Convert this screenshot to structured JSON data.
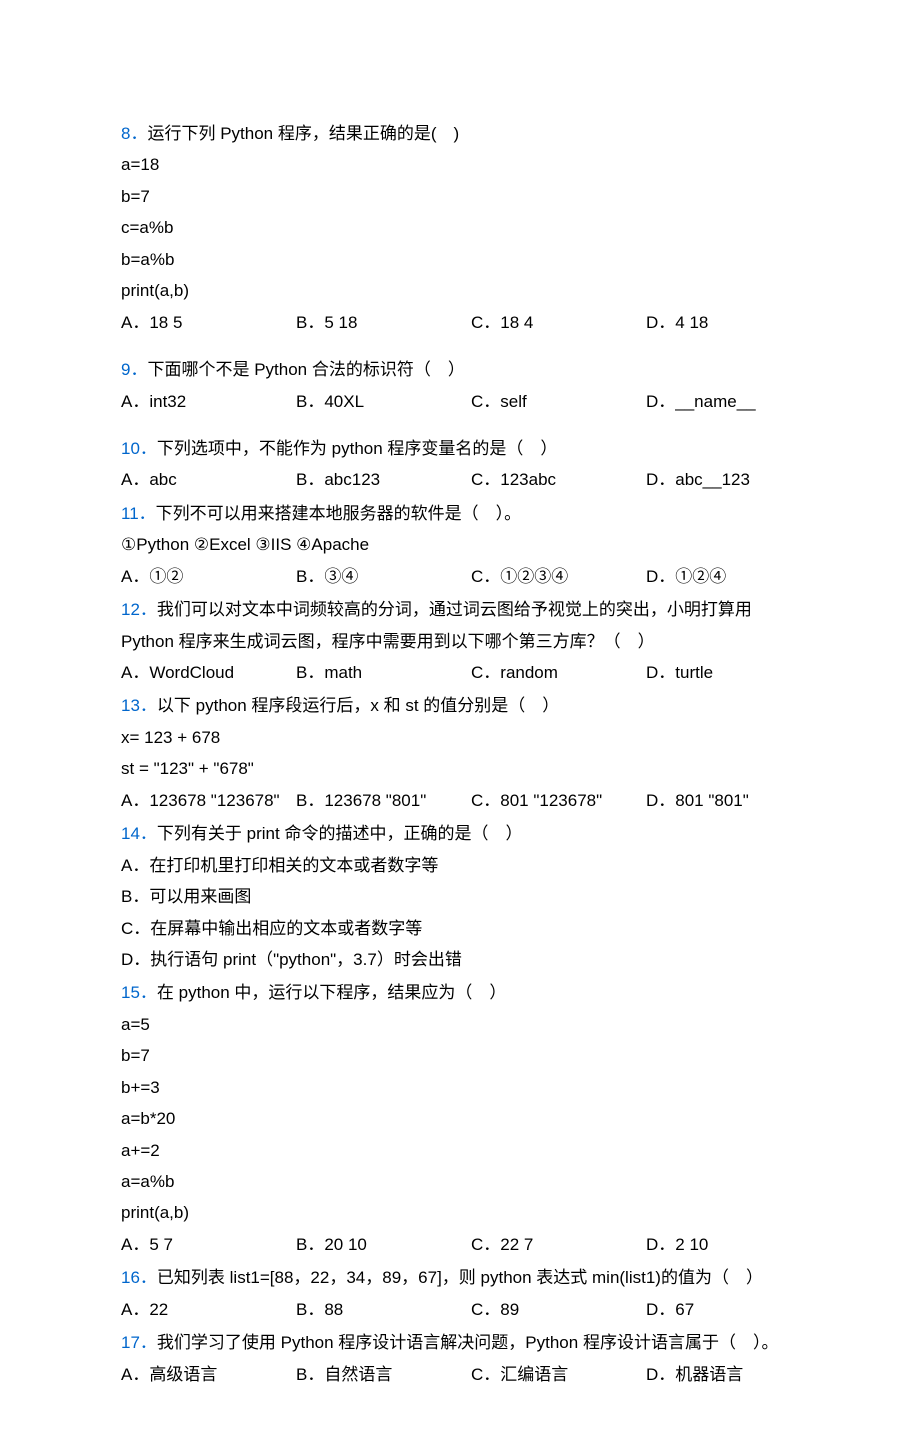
{
  "questions": [
    {
      "num": "8．",
      "text": "运行下列 Python 程序，结果正确的是(　)",
      "code": [
        "a=18",
        "b=7",
        "c=a%b",
        "b=a%b",
        "print(a,b)"
      ],
      "options": [
        {
          "label": "A．18  5"
        },
        {
          "label": "B．5  18"
        },
        {
          "label": "C．18  4"
        },
        {
          "label": "D．4  18"
        }
      ],
      "spacer_after": true
    },
    {
      "num": "9．",
      "text": "下面哪个不是 Python 合法的标识符（　）",
      "code": [],
      "options": [
        {
          "label": "A．int32"
        },
        {
          "label": "B．40XL"
        },
        {
          "label": "C．self"
        },
        {
          "label": "D．__name__"
        }
      ],
      "spacer_after": true
    },
    {
      "num": "10．",
      "text": "下列选项中，不能作为 python 程序变量名的是（　）",
      "code": [],
      "options": [
        {
          "label": "A．abc"
        },
        {
          "label": "B．abc123"
        },
        {
          "label": "C．123abc"
        },
        {
          "label": "D．abc__123"
        }
      ],
      "spacer_after": false
    },
    {
      "num": "11．",
      "text": "下列不可以用来搭建本地服务器的软件是（　）。",
      "code": [
        "①Python ②Excel ③IIS ④Apache"
      ],
      "options": [
        {
          "label": "A．①②"
        },
        {
          "label": "B．③④"
        },
        {
          "label": "C．①②③④"
        },
        {
          "label": "D．①②④"
        }
      ],
      "spacer_after": false
    },
    {
      "num": "12．",
      "text": "我们可以对文本中词频较高的分词，通过词云图给予视觉上的突出，小明打算用",
      "text2": "Python 程序来生成词云图，程序中需要用到以下哪个第三方库？（　）",
      "code": [],
      "options": [
        {
          "label": "A．WordCloud"
        },
        {
          "label": "B．math"
        },
        {
          "label": "C．random"
        },
        {
          "label": "D．turtle"
        }
      ],
      "spacer_after": false
    },
    {
      "num": "13．",
      "text": "以下 python 程序段运行后，x 和 st 的值分别是（　）",
      "code": [
        "x= 123 + 678",
        "st = \"123\" + \"678\""
      ],
      "options": [
        {
          "label": "A．123678 \"123678\""
        },
        {
          "label": "B．123678 \"801\""
        },
        {
          "label": "C．801 \"123678\""
        },
        {
          "label": "D．801 \"801\""
        }
      ],
      "spacer_after": false
    },
    {
      "num": "14．",
      "text": "下列有关于 print 命令的描述中，正确的是（　）",
      "code": [],
      "options_full": [
        {
          "label": "A．在打印机里打印相关的文本或者数字等"
        },
        {
          "label": "B．可以用来画图"
        },
        {
          "label": "C．在屏幕中输出相应的文本或者数字等"
        },
        {
          "label": "D．执行语句 print（\"python\"，3.7）时会出错"
        }
      ],
      "spacer_after": false
    },
    {
      "num": "15．",
      "text": "在 python 中，运行以下程序，结果应为（　）",
      "code": [
        "a=5",
        "b=7",
        "b+=3",
        "a=b*20",
        "a+=2",
        "a=a%b",
        "print(a,b)"
      ],
      "options": [
        {
          "label": "A．5  7"
        },
        {
          "label": "B．20  10"
        },
        {
          "label": "C．22  7"
        },
        {
          "label": "D．2  10"
        }
      ],
      "spacer_after": false
    },
    {
      "num": "16．",
      "text": "已知列表 list1=[88，22，34，89，67]，则 python 表达式 min(list1)的值为（　）",
      "code": [],
      "options": [
        {
          "label": "A．22"
        },
        {
          "label": "B．88"
        },
        {
          "label": "C．89"
        },
        {
          "label": "D．67"
        }
      ],
      "spacer_after": false
    },
    {
      "num": "17．",
      "text": "我们学习了使用 Python 程序设计语言解决问题，Python 程序设计语言属于（　）。",
      "code": [],
      "options": [
        {
          "label": "A．高级语言"
        },
        {
          "label": "B．自然语言"
        },
        {
          "label": "C．汇编语言"
        },
        {
          "label": "D．机器语言"
        }
      ],
      "spacer_after": false
    }
  ]
}
